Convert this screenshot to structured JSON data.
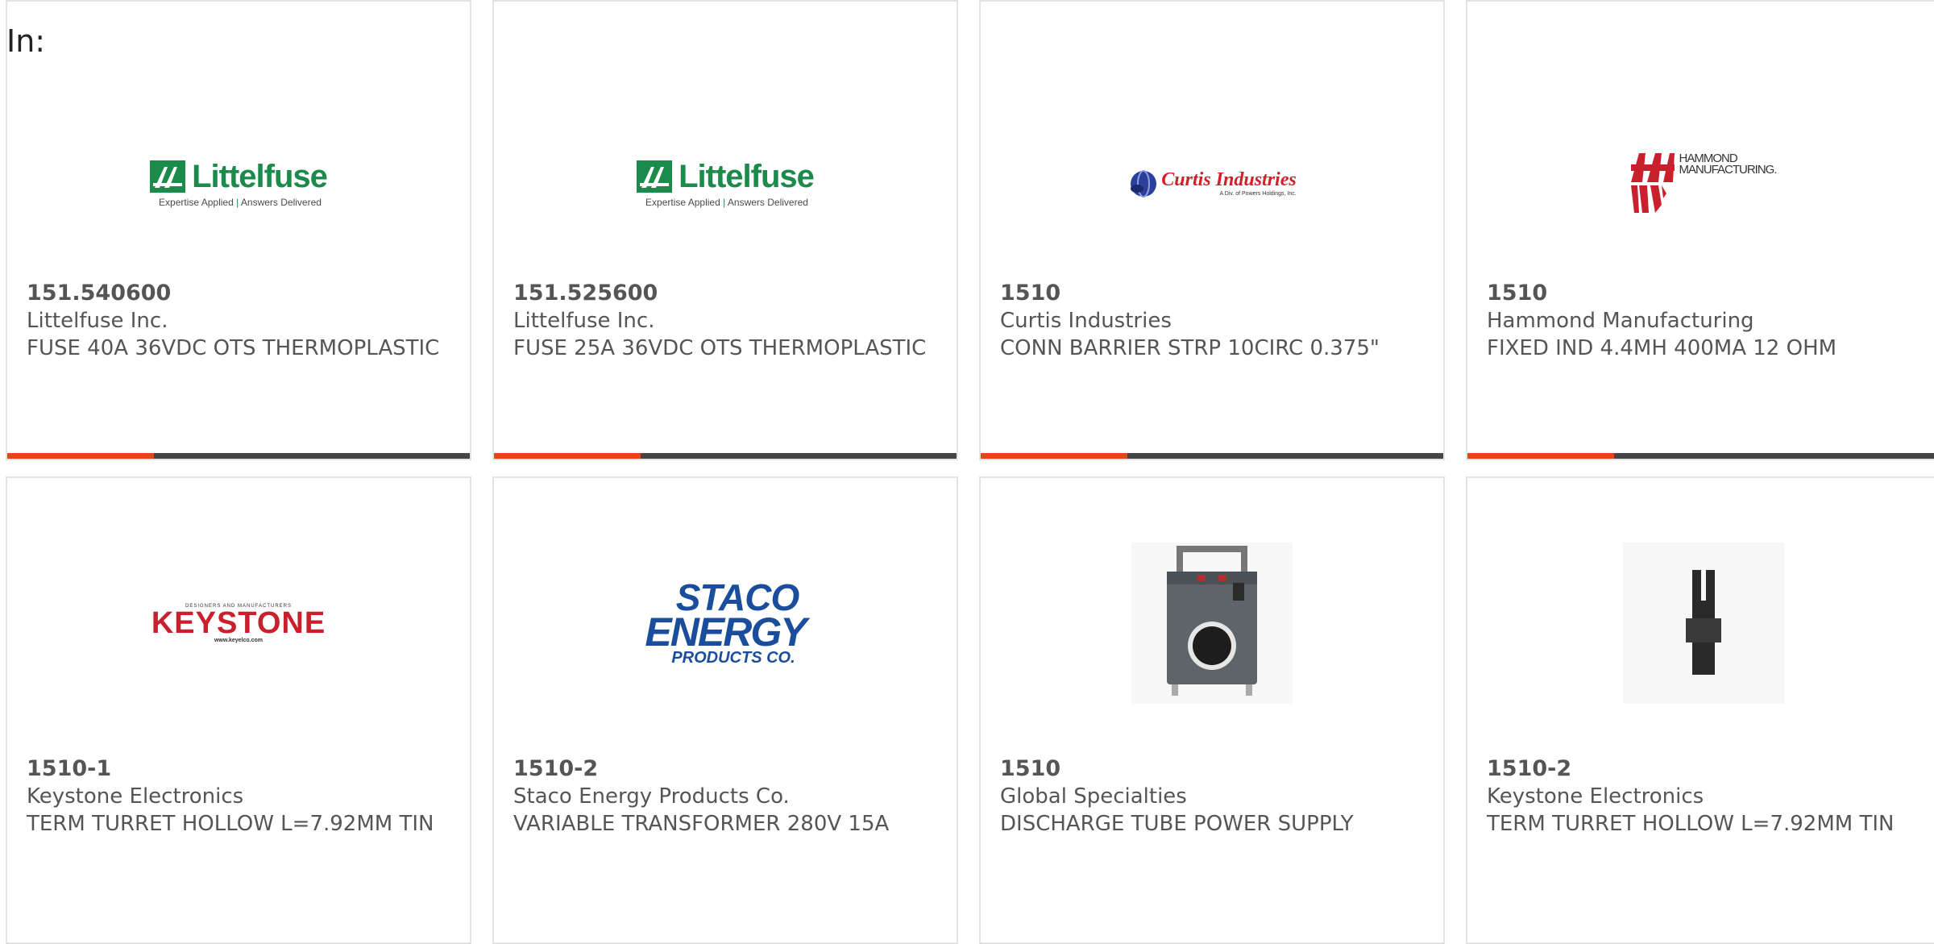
{
  "header": {
    "in_label": "In:"
  },
  "colors": {
    "accent": "#e44617",
    "bar_dark": "#454545",
    "text": "#555555",
    "border": "#e4e4e4"
  },
  "cards": [
    {
      "part_number": "151.540600",
      "manufacturer": "Littelfuse Inc.",
      "description": "FUSE 40A 36VDC OTS THERMOPLASTIC",
      "image": "littelfuse-logo",
      "logo_word": "Littelfuse",
      "logo_tagline_a": "Expertise Applied",
      "logo_tagline_sep": "|",
      "logo_tagline_b": "Answers Delivered"
    },
    {
      "part_number": "151.525600",
      "manufacturer": "Littelfuse Inc.",
      "description": "FUSE 25A 36VDC OTS THERMOPLASTIC",
      "image": "littelfuse-logo",
      "logo_word": "Littelfuse",
      "logo_tagline_a": "Expertise Applied",
      "logo_tagline_sep": "|",
      "logo_tagline_b": "Answers Delivered"
    },
    {
      "part_number": "1510",
      "manufacturer": "Curtis Industries",
      "description": "CONN BARRIER STRP 10CIRC 0.375\"",
      "image": "curtis-industries-logo",
      "logo_word": "Curtis Industries",
      "logo_sub": "A Div. of Powers Holdings, Inc."
    },
    {
      "part_number": "1510",
      "manufacturer": "Hammond Manufacturing",
      "description": "FIXED IND 4.4MH 400MA 12 OHM",
      "image": "hammond-logo",
      "logo_line1": "HAMMOND",
      "logo_line2": "MANUFACTURING."
    },
    {
      "part_number": "1510-1",
      "manufacturer": "Keystone Electronics",
      "description": "TERM TURRET HOLLOW L=7.92MM TIN",
      "image": "keystone-logo",
      "logo_top": "DESIGNERS AND MANUFACTURERS",
      "logo_word": "KEYSTONE",
      "logo_sub": "www.keyelco.com"
    },
    {
      "part_number": "1510-2",
      "manufacturer": "Staco Energy Products Co.",
      "description": "VARIABLE TRANSFORMER 280V 15A",
      "image": "staco-energy-logo",
      "logo_line1": "STACO",
      "logo_line2": "ENERGY",
      "logo_line3": "PRODUCTS CO."
    },
    {
      "part_number": "1510",
      "manufacturer": "Global Specialties",
      "description": "DISCHARGE TUBE POWER SUPPLY",
      "image": "discharge-tube-power-supply-photo"
    },
    {
      "part_number": "1510-2",
      "manufacturer": "Keystone Electronics",
      "description": "TERM TURRET HOLLOW L=7.92MM TIN",
      "image": "turret-terminal-photo"
    }
  ]
}
